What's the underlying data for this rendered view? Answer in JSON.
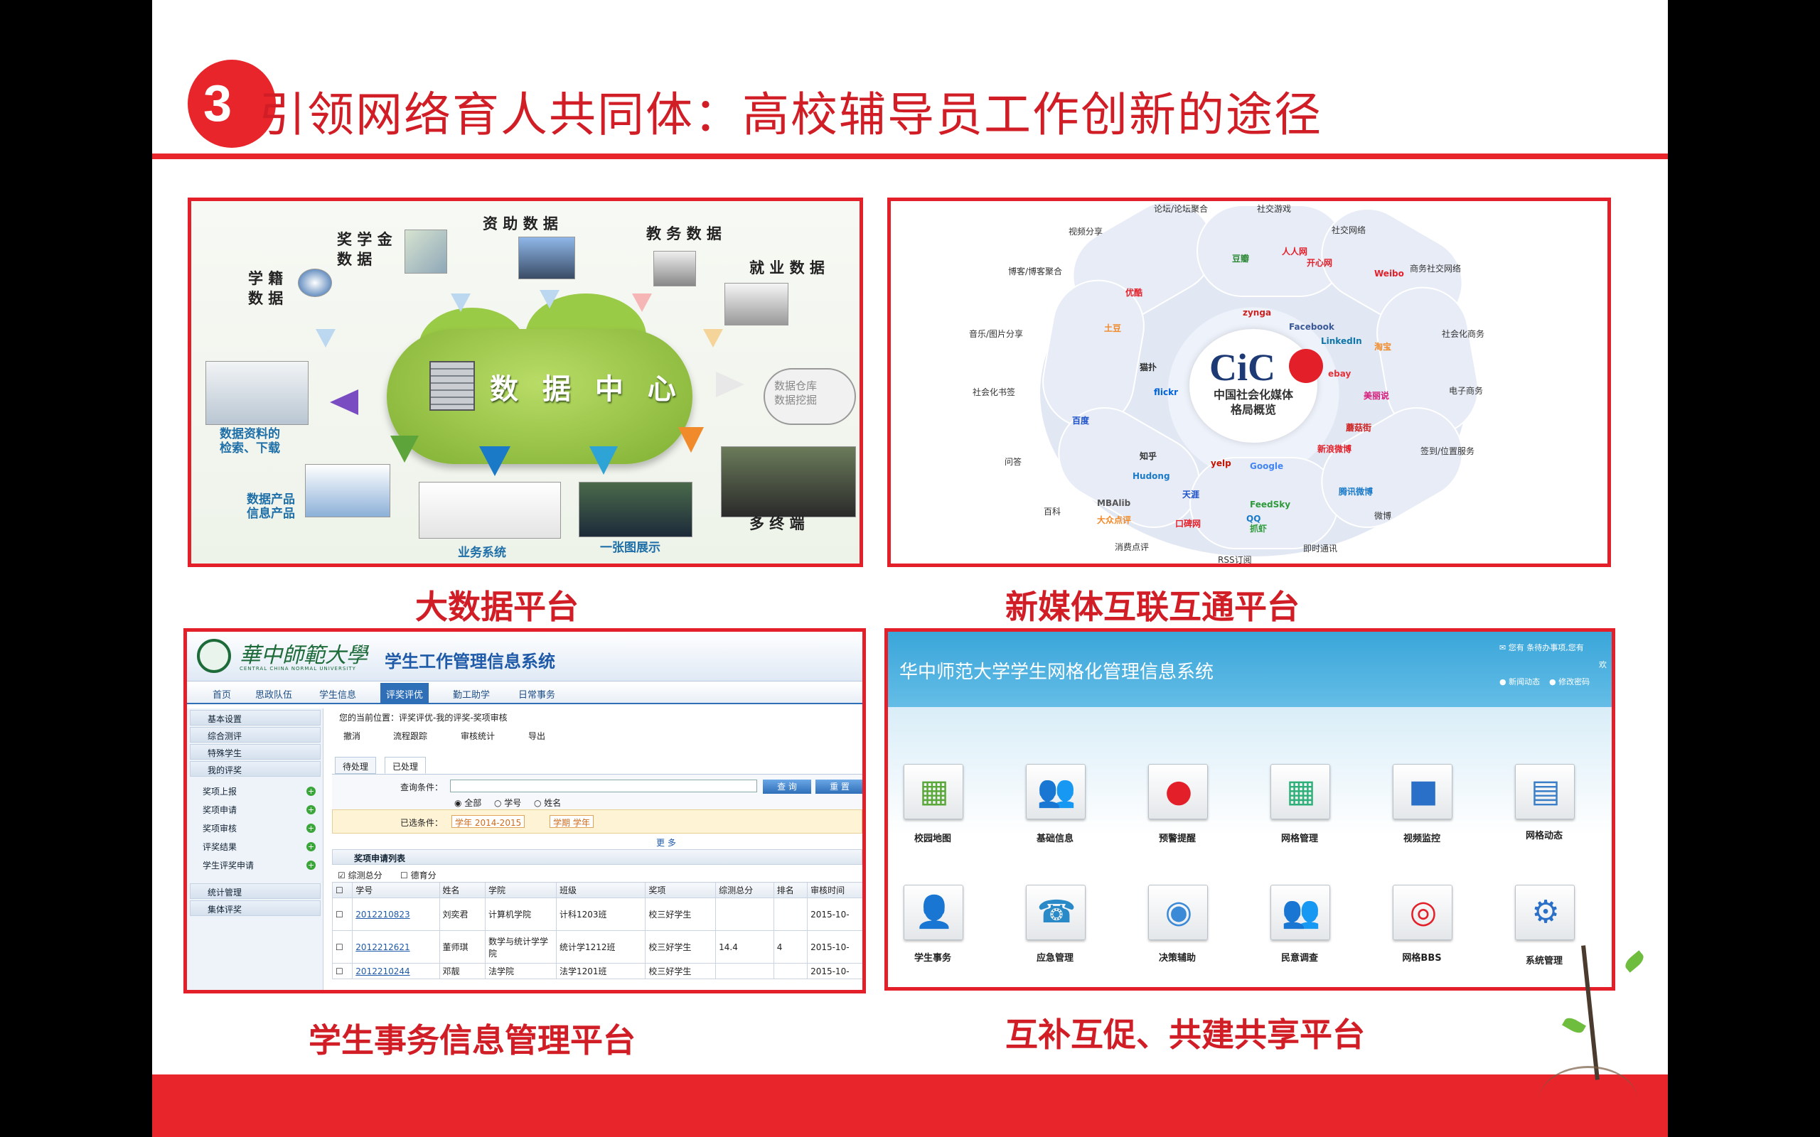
{
  "header": {
    "badge": "3",
    "title": "引领网络育人共同体：高校辅导员工作创新的途径"
  },
  "panels": {
    "big_data": {
      "caption": "大数据平台",
      "center_label": "数 据 中 心",
      "sources": {
        "xueji": "学 籍\n数 据",
        "jiangxuejin": "奖 学 金\n数 据",
        "zizhu": "资 助 数 据",
        "jiaowu": "教 务 数 据",
        "jiuye": "就 业 数 据"
      },
      "outputs": {
        "download": "数据资料的\n检索、下载",
        "products": "数据产品\n信息产品",
        "business": "业务系统",
        "map": "一张图展示",
        "terminal": "多 终 端",
        "warehouse": "数据仓库\n数据挖掘"
      }
    },
    "new_media": {
      "caption": "新媒体互联互通平台",
      "logo": "CiC",
      "center_text": "中国社会化媒体\n格局概览",
      "categories": [
        "论坛/论坛聚合",
        "社交游戏",
        "社交网络",
        "商务社交网络",
        "社会化商务",
        "电子商务",
        "签到/位置服务",
        "微博",
        "即时通讯",
        "RSS订阅",
        "消费点评",
        "百科",
        "问答",
        "社会化书签",
        "音乐/图片分享",
        "博客/博客聚合",
        "视频分享"
      ],
      "brands": [
        "人人网",
        "开心网",
        "豆瓣",
        "新浪微博",
        "腾讯微博",
        "QQ",
        "百度",
        "优酷",
        "淘宝",
        "蘑菇街",
        "美丽说",
        "大众点评",
        "土豆",
        "Hudong",
        "MBAlib",
        "知乎",
        "天涯",
        "猫扑",
        "flickr",
        "LinkedIn",
        "Facebook",
        "ebay",
        "zynga",
        "Google",
        "yelp",
        "FeedSky",
        "抓虾",
        "口碑网",
        "Weibo"
      ]
    },
    "student_affairs": {
      "caption": "学生事务信息管理平台",
      "univ_cn": "華中師範大學",
      "univ_en": "CENTRAL CHINA NORMAL UNIVERSITY",
      "system_title": "学生工作管理信息系统",
      "nav": [
        "首页",
        "思政队伍",
        "学生信息",
        "评奖评优",
        "勤工助学",
        "日常事务"
      ],
      "nav_active": "评奖评优",
      "side_groups_top": [
        "基本设置",
        "综合测评",
        "特殊学生",
        "我的评奖"
      ],
      "side_items": [
        "奖项上报",
        "奖项申请",
        "奖项审核",
        "评奖结果",
        "学生评奖申请"
      ],
      "side_groups_bottom": [
        "统计管理",
        "集体评奖"
      ],
      "breadcrumb": "您的当前位置：评奖评优-我的评奖-奖项审核",
      "toolbar": [
        "撤消",
        "流程跟踪",
        "审核统计",
        "导出"
      ],
      "tabs": [
        "待处理",
        "已处理"
      ],
      "query_label": "查询条件：",
      "query_btn": "查 询",
      "reset_btn": "重 置",
      "radios": [
        "全部",
        "学号",
        "姓名"
      ],
      "selected_label": "已选条件：",
      "selected_tags": [
        "学年 2014-2015",
        "学期 学年"
      ],
      "more": "更 多",
      "list_title": "奖项申请列表",
      "checks": [
        "综测总分",
        "德育分"
      ],
      "columns": [
        "学号",
        "姓名",
        "学院",
        "班级",
        "奖项",
        "综测总分",
        "排名",
        "审核时间"
      ],
      "rows": [
        {
          "id": "2012210823",
          "name": "刘奕君",
          "college": "计算机学院",
          "class": "计科1203班",
          "award": "校三好学生",
          "score": "",
          "rank": "",
          "time": "2015-10-"
        },
        {
          "id": "2012212621",
          "name": "董师琪",
          "college": "数学与统计学学院",
          "class": "统计学1212班",
          "award": "校三好学生",
          "score": "14.4",
          "rank": "4",
          "time": "2015-10-"
        },
        {
          "id": "2012210244",
          "name": "邓靓",
          "college": "法学院",
          "class": "法学1201班",
          "award": "校三好学生",
          "score": "",
          "rank": "",
          "time": "2015-10-"
        }
      ]
    },
    "grid_management": {
      "caption": "互补互促、共建共享平台",
      "title": "华中师范大学学生网格化管理信息系统",
      "top_right": {
        "notice": "您有 条待办事项,您有",
        "welcome": "欢",
        "news": "新闻动态",
        "password": "修改密码"
      },
      "tiles": [
        {
          "label": "校园地图",
          "icon": "map-icon"
        },
        {
          "label": "基础信息",
          "icon": "people-icon"
        },
        {
          "label": "预警提醒",
          "icon": "siren-icon"
        },
        {
          "label": "网格管理",
          "icon": "grid-icon"
        },
        {
          "label": "视频监控",
          "icon": "camera-icon"
        },
        {
          "label": "网格动态",
          "icon": "profile-icon"
        },
        {
          "label": "学生事务",
          "icon": "student-icon"
        },
        {
          "label": "应急管理",
          "icon": "phone-icon"
        },
        {
          "label": "决策辅助",
          "icon": "globe-icon"
        },
        {
          "label": "民意调查",
          "icon": "survey-icon"
        },
        {
          "label": "网格BBS",
          "icon": "bbs-icon"
        },
        {
          "label": "系统管理",
          "icon": "gear-icon"
        }
      ]
    }
  },
  "colors": {
    "brand_red": "#e3202a",
    "title_red": "#d11e26",
    "system_blue": "#2f6fb8",
    "sky_blue": "#3aa6da"
  }
}
